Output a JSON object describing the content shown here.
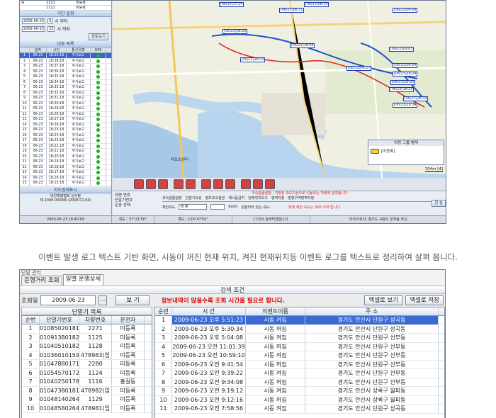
{
  "top_screen": {
    "mini_rows": [
      {
        "a": "⊕",
        "b": "1121",
        "c": "미등록"
      },
      {
        "a": "",
        "b": "1121",
        "c": "미등록"
      }
    ],
    "period_title": "기간 설정",
    "date_from": "2009-06-23",
    "hour_from": "0",
    "from_label": "시 부터",
    "date_to": "2009-06-23",
    "hour_to": "23",
    "to_label": "시 까지",
    "route_button": "경로보기",
    "detail_title": "이동 목록",
    "grid_headers": [
      "일자",
      "시간",
      "통신유형",
      "GPS"
    ],
    "grid_rows": [
      {
        "n": "1",
        "d": "06-23",
        "t": "18:39:18",
        "s": "주기보고"
      },
      {
        "n": "2",
        "d": "06-23",
        "t": "18:38:18",
        "s": "주기보고"
      },
      {
        "n": "3",
        "d": "06-23",
        "t": "18:37:18",
        "s": "주기보고"
      },
      {
        "n": "4",
        "d": "06-23",
        "t": "18:36:18",
        "s": "주기보고"
      },
      {
        "n": "5",
        "d": "06-23",
        "t": "18:35:18",
        "s": "주기보고"
      },
      {
        "n": "6",
        "d": "06-23",
        "t": "18:34:18",
        "s": "주기보고"
      },
      {
        "n": "7",
        "d": "06-23",
        "t": "18:33:18",
        "s": "주기보고"
      },
      {
        "n": "8",
        "d": "06-23",
        "t": "18:32:18",
        "s": "주기보고"
      },
      {
        "n": "9",
        "d": "06-23",
        "t": "18:31:18",
        "s": "주기보고"
      },
      {
        "n": "10",
        "d": "06-23",
        "t": "18:30:18",
        "s": "주기보고"
      },
      {
        "n": "11",
        "d": "06-23",
        "t": "18:29:18",
        "s": "주기보고"
      },
      {
        "n": "12",
        "d": "06-23",
        "t": "18:28:18",
        "s": "주기보고"
      },
      {
        "n": "13",
        "d": "06-23",
        "t": "18:27:18",
        "s": "주기보고"
      },
      {
        "n": "14",
        "d": "06-23",
        "t": "18:26:18",
        "s": "주기보고"
      },
      {
        "n": "15",
        "d": "06-23",
        "t": "18:25:18",
        "s": "주기보고"
      },
      {
        "n": "16",
        "d": "06-23",
        "t": "18:24:18",
        "s": "주기보고"
      },
      {
        "n": "17",
        "d": "06-23",
        "t": "18:23:18",
        "s": "주기보고"
      },
      {
        "n": "18",
        "d": "06-23",
        "t": "18:22:18",
        "s": "주기보고"
      },
      {
        "n": "19",
        "d": "06-23",
        "t": "18:21:18",
        "s": "주기보고"
      },
      {
        "n": "20",
        "d": "06-23",
        "t": "18:20:18",
        "s": "주기보고"
      },
      {
        "n": "21",
        "d": "06-23",
        "t": "18:19:18",
        "s": "주기보고"
      },
      {
        "n": "22",
        "d": "06-23",
        "t": "18:18:18",
        "s": "주기보고"
      },
      {
        "n": "23",
        "d": "06-23",
        "t": "18:17:18",
        "s": "주기보고"
      },
      {
        "n": "24",
        "d": "06-23",
        "t": "18:16:18",
        "s": "주기보고"
      },
      {
        "n": "25",
        "d": "06-23",
        "t": "18:15:18",
        "s": "주기보고"
      }
    ],
    "address_title": "지도범례표시",
    "address_text": "대한측량협회 심사필\n제 2008-0009호 (2008.01.04)",
    "map_labels": [
      "[06/23]17:24",
      "[06/23]08:31",
      "[06/23]08:34",
      "[06/23]08:25",
      "[06/23]09:08",
      "[06/23]18:08",
      "[06/23]09:05",
      "[06/23]09:04",
      "[06/23]18:24",
      "[06/23]18:25",
      "[06/23]18:29",
      "[06/23]18:39",
      "[06/23]18:34",
      "[06/23]18:03",
      "[06/23]08:27"
    ],
    "legend_title": "차량 그룹 범례",
    "legend_item": "[미등록]",
    "scale_text": "704m [4]",
    "place_label": "레포츠센터",
    "info_labels": [
      "차량 번호",
      "단말기번호",
      "운송 상태"
    ],
    "alarm_title": "과속알람설정 : 지정된 속도이상으로 이동하는 차량에 알려줍니다",
    "alarm_tabs": [
      "과속알람설정",
      "단말기속성",
      "정차보고설정",
      "재시동금지",
      "현재위치보고",
      "영역지정",
      "방향구역영역지정"
    ],
    "limit_label": "제한속도",
    "limit_value": "제 제",
    "unit": "Km/h",
    "limit_note": "설정되어 있는 속도:",
    "max_speed": "최대 제한 속도는 300 이하 입니다.",
    "apply_btn": "전 송",
    "status": [
      "2009-06-23 18:40:09",
      "위도 : 37°21'50\"",
      "경도 : 126°47'50\"",
      "17건이 검색되었습니다.",
      "마우스위치: 경기도 시흥시 군자동 부근"
    ]
  },
  "caption": "이벤트 발생 로그 텍스트 기반 화면, 시동이 꺼진 현재 위치, 켜진 현재위치등 이벤트 로그를 텍스트로 정리하여 살펴 봅니다.",
  "bottom_screen": {
    "window_title": "단말 관리",
    "tabs": [
      "운행거리 조회",
      "일별 운행상세"
    ],
    "search_title": "검색 조건",
    "date_label": "조회일",
    "date_value": "2009-06-23",
    "view_btn": "보 기",
    "notice": "정보내역이 많을수록 조회 시간을 필요로 합니다.",
    "excel_view": "엑셀로 보기",
    "excel_save": "엑셀로 저장",
    "device_list_title": "단말기 목록",
    "device_headers": [
      "순번",
      "단말기번호",
      "차량번호",
      "운전자"
    ],
    "devices": [
      {
        "n": "1",
        "tel": "01085020181",
        "car": "2271",
        "drv": "미등록"
      },
      {
        "n": "2",
        "tel": "01091380182",
        "car": "1125",
        "drv": "미등록"
      },
      {
        "n": "3",
        "tel": "01040510182",
        "car": "1128",
        "drv": "미등록"
      },
      {
        "n": "4",
        "tel": "01036010159",
        "car": "478983(임",
        "drv": "미등록"
      },
      {
        "n": "5",
        "tel": "01047880171",
        "car": "2280",
        "drv": "미등록"
      },
      {
        "n": "6",
        "tel": "01054570172",
        "car": "1124",
        "drv": "미등록"
      },
      {
        "n": "7",
        "tel": "01040250178",
        "car": "1116",
        "drv": "홍길동"
      },
      {
        "n": "8",
        "tel": "01047380181",
        "car": "478982(임",
        "drv": "미등록"
      },
      {
        "n": "9",
        "tel": "01048140264",
        "car": "1129",
        "drv": "미등록"
      },
      {
        "n": "10",
        "tel": "01048580264",
        "car": "478981(임",
        "drv": "미등록"
      }
    ],
    "event_headers": [
      "순번",
      "시 간",
      "이벤트이름",
      "주 소"
    ],
    "events": [
      {
        "n": "1",
        "t": "2009-06-23 오후 5:51:23",
        "e": "시동 켜짐",
        "a": "경기도 안산시 단원구 성곡동"
      },
      {
        "n": "2",
        "t": "2009-06-23 오후 5:30:34",
        "e": "시동 꺼짐",
        "a": "경기도 안산시 단원구 성곡동"
      },
      {
        "n": "3",
        "t": "2009-06-23 오후 5:04:08",
        "e": "시동 켜짐",
        "a": "경기도 안산시 단원구 선부동"
      },
      {
        "n": "4",
        "t": "2009-06-23 오전 11:01:39",
        "e": "시동 꺼짐",
        "a": "경기도 안산시 단원구 선부동"
      },
      {
        "n": "5",
        "t": "2009-06-23 오전 10:59:10",
        "e": "시동 켜짐",
        "a": "경기도 안산시 단원구 선부동"
      },
      {
        "n": "6",
        "t": "2009-06-23 오전 9:41:54",
        "e": "시동 꺼짐",
        "a": "경기도 안산시 단원구 선부동"
      },
      {
        "n": "7",
        "t": "2009-06-23 오전 9:39:22",
        "e": "시동 켜짐",
        "a": "경기도 안산시 단원구 선부동"
      },
      {
        "n": "8",
        "t": "2009-06-23 오전 9:34:08",
        "e": "시동 꺼짐",
        "a": "경기도 안산시 단원구 선부동"
      },
      {
        "n": "9",
        "t": "2009-06-23 오전 9:19:12",
        "e": "시동 켜짐",
        "a": "경기도 안산시 상록구 월피동"
      },
      {
        "n": "10",
        "t": "2009-06-23 오전 9:12:16",
        "e": "시동 꺼짐",
        "a": "경기도 안산시 상록구 월피동"
      },
      {
        "n": "11",
        "t": "2009-06-23 오전 7:58:56",
        "e": "시동 켜짐",
        "a": "경기도 안산시 단원구 성곡동"
      }
    ]
  }
}
